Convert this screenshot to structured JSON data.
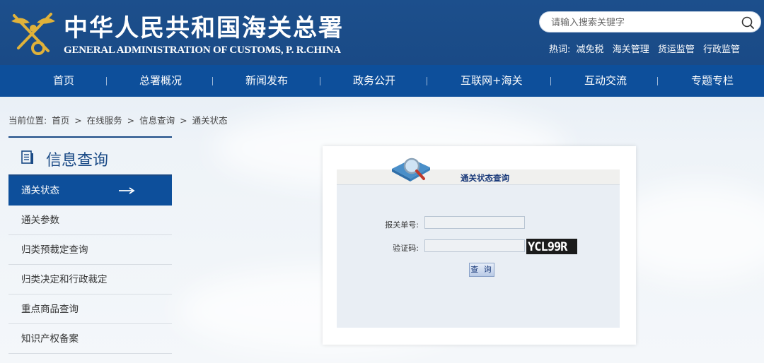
{
  "header": {
    "title_cn": "中华人民共和国海关总署",
    "title_en": "GENERAL ADMINISTRATION OF CUSTOMS, P. R.CHINA",
    "search": {
      "placeholder": "请输入搜索关键字",
      "icon": "search-icon"
    },
    "hotwords_label": "热词:",
    "hotwords": [
      "减免税",
      "海关管理",
      "货运监管",
      "行政监管"
    ]
  },
  "nav": {
    "items": [
      "首页",
      "总署概况",
      "新闻发布",
      "政务公开",
      "互联网+海关",
      "互动交流",
      "专题专栏"
    ]
  },
  "breadcrumb": {
    "prefix": "当前位置:",
    "items": [
      "首页",
      "在线服务",
      "信息查询",
      "通关状态"
    ],
    "separator": ">"
  },
  "sidebar": {
    "title": "信息查询",
    "items": [
      {
        "label": "通关状态",
        "active": true
      },
      {
        "label": "通关参数",
        "active": false
      },
      {
        "label": "归类预裁定查询",
        "active": false
      },
      {
        "label": "归类决定和行政裁定",
        "active": false
      },
      {
        "label": "重点商品查询",
        "active": false
      },
      {
        "label": "知识产权备案",
        "active": false
      }
    ]
  },
  "panel": {
    "title": "通关状态查询",
    "fields": {
      "declaration_label": "报关单号:",
      "declaration_value": "",
      "captcha_label": "验证码:",
      "captcha_value": "",
      "captcha_text": "YCL99R"
    },
    "query_button": "查 询"
  },
  "colors": {
    "header_bg": "#1a4a86",
    "nav_bg": "#0d4f9b",
    "active_item_bg": "#0d4f9b"
  }
}
